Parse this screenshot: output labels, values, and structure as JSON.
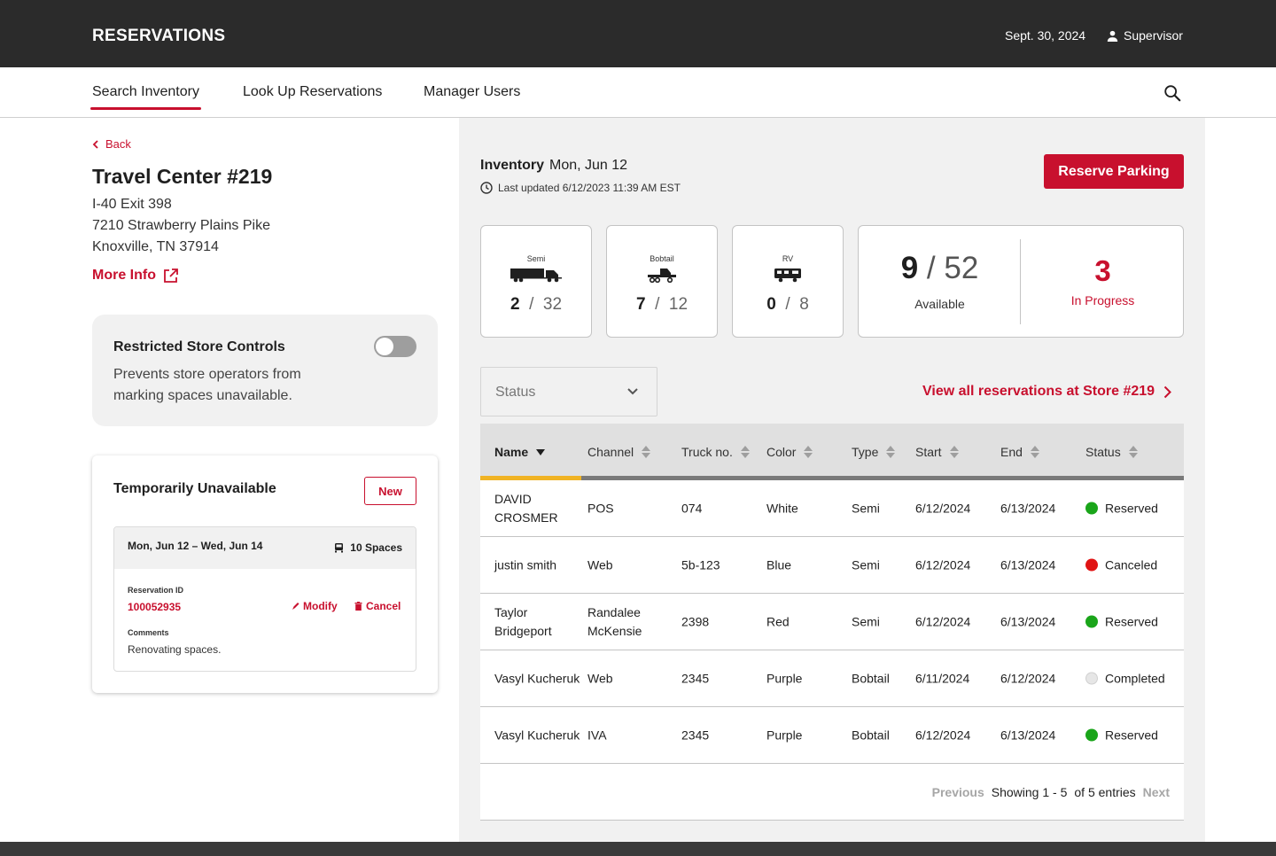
{
  "header": {
    "brand": "RESERVATIONS",
    "date": "Sept. 30, 2024",
    "user": "Supervisor"
  },
  "nav": {
    "items": [
      "Search Inventory",
      "Look Up Reservations",
      "Manager Users"
    ],
    "active": "Search Inventory"
  },
  "store": {
    "back": "Back",
    "title": "Travel Center #219",
    "address": [
      "I-40 Exit 398",
      "7210 Strawberry Plains Pike",
      "Knoxville, TN 37914"
    ],
    "more_info": "More Info"
  },
  "restricted": {
    "title": "Restricted Store Controls",
    "description": "Prevents store operators from marking spaces unavailable.",
    "enabled": false
  },
  "unavailable": {
    "title": "Temporarily Unavailable",
    "new_label": "New",
    "dates": "Mon, Jun 12 – Wed, Jun 14",
    "spaces": "10 Spaces",
    "reservation_id_label": "Reservation ID",
    "reservation_id": "100052935",
    "modify": "Modify",
    "cancel": "Cancel",
    "comments_label": "Comments",
    "comment": "Renovating spaces."
  },
  "inventory": {
    "label": "Inventory",
    "date": "Mon, Jun 12",
    "updated": "Last updated 6/12/2023 11:39 AM EST",
    "reserve_button": "Reserve Parking",
    "vehicles": [
      {
        "label": "Semi",
        "icon": "semi-truck-icon",
        "used": "2",
        "total": "32"
      },
      {
        "label": "Bobtail",
        "icon": "bobtail-truck-icon",
        "used": "7",
        "total": "12"
      },
      {
        "label": "RV",
        "icon": "rv-icon",
        "used": "0",
        "total": "8"
      }
    ],
    "available_count": "9",
    "available_total": "52",
    "available_label": "Available",
    "in_progress_count": "3",
    "in_progress_label": "In Progress"
  },
  "filter": {
    "status_placeholder": "Status",
    "view_all": "View all reservations at Store #219"
  },
  "table": {
    "columns": [
      "Name",
      "Channel",
      "Truck no.",
      "Color",
      "Type",
      "Start",
      "End",
      "Status"
    ],
    "rows": [
      {
        "name": "DAVID CROSMER",
        "channel": "POS",
        "truck": "074",
        "color": "White",
        "type": "Semi",
        "start": "6/12/2024",
        "end": "6/13/2024",
        "status": "Reserved",
        "status_color": "#1aa51a"
      },
      {
        "name": "justin smith",
        "channel": "Web",
        "truck": "5b-123",
        "color": "Blue",
        "type": "Semi",
        "start": "6/12/2024",
        "end": "6/13/2024",
        "status": "Canceled",
        "status_color": "#e01414"
      },
      {
        "name": "Taylor Bridgeport",
        "channel": "Randalee McKensie",
        "truck": "2398",
        "color": "Red",
        "type": "Semi",
        "start": "6/12/2024",
        "end": "6/13/2024",
        "status": "Reserved",
        "status_color": "#1aa51a"
      },
      {
        "name": "Vasyl Kucheruk",
        "channel": "Web",
        "truck": "2345",
        "color": "Purple",
        "type": "Bobtail",
        "start": "6/11/2024",
        "end": "6/12/2024",
        "status": "Completed",
        "status_color": "#e6e6e6"
      },
      {
        "name": "Vasyl Kucheruk",
        "channel": "IVA",
        "truck": "2345",
        "color": "Purple",
        "type": "Bobtail",
        "start": "6/12/2024",
        "end": "6/13/2024",
        "status": "Reserved",
        "status_color": "#1aa51a"
      }
    ],
    "pager": {
      "previous": "Previous",
      "showing": "Showing 1 - 5",
      "of": "of 5 entries",
      "next": "Next"
    }
  },
  "colors": {
    "brand_red": "#c8102e",
    "topbar": "#2b2b2b",
    "sort_accent": "#f0b323"
  }
}
